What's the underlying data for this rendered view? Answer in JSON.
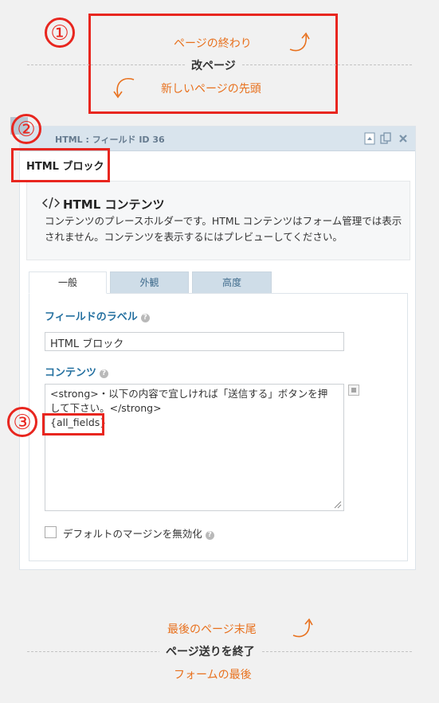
{
  "annotations": {
    "one": "①",
    "two": "②",
    "three": "③"
  },
  "page_break": {
    "page_end": "ページの終わり",
    "label": "改ページ",
    "next_page_start": "新しいページの先頭"
  },
  "field": {
    "header_title": "HTML : フィールド ID 36",
    "type_label": "HTML ブロック",
    "info_title": "HTML コンテンツ",
    "info_text": "コンテンツのプレースホルダーです。HTML コンテンツはフォーム管理では表示されません。コンテンツを表示するにはプレビューしてください。",
    "tabs": [
      {
        "label": "一般"
      },
      {
        "label": "外観"
      },
      {
        "label": "高度"
      }
    ],
    "label_field_title": "フィールドのラベル",
    "label_value": "HTML ブロック",
    "content_title": "コンテンツ",
    "content_line1": "<strong>・以下の内容で宜しければ「送信する」ボタンを押",
    "content_line2": "して下さい。</strong>",
    "content_line3": "{all_fields}",
    "disable_margin_label": "デフォルトのマージンを無効化"
  },
  "form_end": {
    "last_page_end": "最後のページ末尾",
    "label": "ページ送りを終了",
    "form_end_label": "フォームの最後"
  },
  "colors": {
    "annotation_red": "#e8261f",
    "orange_text": "#e8711e",
    "field_label_blue": "#2470a0"
  }
}
